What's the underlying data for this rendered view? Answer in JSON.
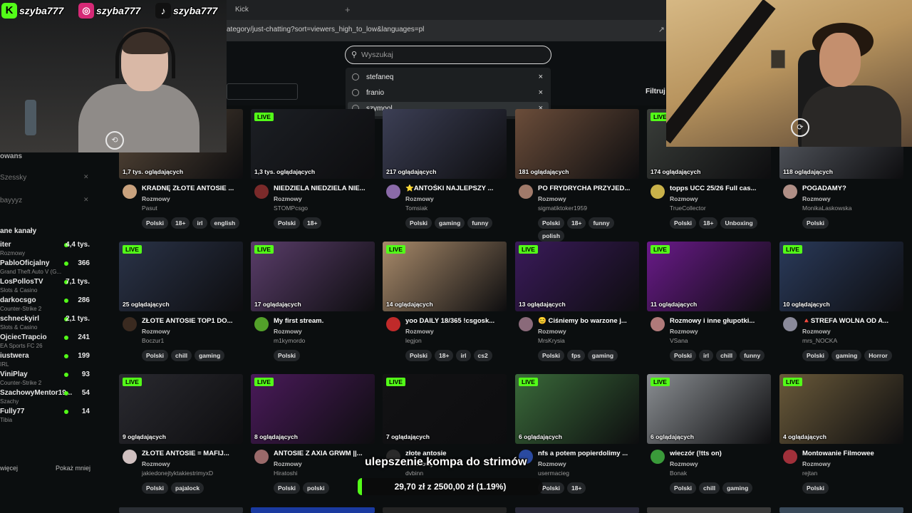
{
  "browser": {
    "tab_title": "Kick",
    "new_tab": "+",
    "url": "ategory/just-chatting?sort=viewers_high_to_low&languages=pl"
  },
  "search": {
    "placeholder": "Wyszukaj",
    "history": [
      {
        "label": "stefaneq",
        "remove": "×"
      },
      {
        "label": "franio",
        "remove": "×"
      },
      {
        "label": "szymool",
        "remove": "×"
      }
    ]
  },
  "filter_label": "Filtruj",
  "socials": [
    {
      "icon": "kick-logo-icon",
      "name": "szyba777",
      "color": "#53fc18"
    },
    {
      "icon": "instagram-icon",
      "name": "szyba777",
      "color": "#d62976"
    },
    {
      "icon": "tiktok-icon",
      "name": "szyba777",
      "color": "#111111"
    }
  ],
  "sidebar": {
    "top_items": [
      {
        "name": "owans"
      },
      {
        "name": "Szessky"
      },
      {
        "name": "bayyyz"
      }
    ],
    "section_title": "ane kanały",
    "channels": [
      {
        "name": "iter",
        "category": "Rozmowy",
        "viewers": "4,4 tys."
      },
      {
        "name": "PabloOficjalny",
        "category": "Grand Theft Auto V (G...",
        "viewers": "366"
      },
      {
        "name": "LosPollosTV",
        "category": "Slots & Casino",
        "viewers": "7,1 tys."
      },
      {
        "name": "darkocsgo",
        "category": "Counter-Strike 2",
        "viewers": "286"
      },
      {
        "name": "schneckyirl",
        "category": "Slots & Casino",
        "viewers": "2,1 tys."
      },
      {
        "name": "OjciecTrapcio",
        "category": "EA Sports FC 26",
        "viewers": "241"
      },
      {
        "name": "iustwera",
        "category": "IRL",
        "viewers": "199"
      },
      {
        "name": "ViniPlay",
        "category": "Counter-Strike 2",
        "viewers": "93"
      },
      {
        "name": "SzachowyMentor19...",
        "category": "Szachy",
        "viewers": "54"
      },
      {
        "name": "Fully77",
        "category": "Tibia",
        "viewers": "14"
      }
    ],
    "show_more": "więcej",
    "show_less": "Pokaż mniej"
  },
  "streams": [
    {
      "live": "",
      "viewers": "1,7 tys. oglądających",
      "title": "KRADNĘ ZŁOTE ANTOSIE ...",
      "category": "Rozmowy",
      "channel": "Pasut",
      "tags": [
        "Polski",
        "18+",
        "irl",
        "english"
      ],
      "thumb": "#5a4a3a",
      "avatar": "#c9a27e"
    },
    {
      "live": "LIVE",
      "viewers": "1,3 tys. oglądających",
      "title": "NIEDZIELA NIEDZIELA NIE...",
      "category": "Rozmowy",
      "channel": "STOMPcsgo",
      "tags": [
        "Polski",
        "18+"
      ],
      "thumb": "#1c1f24",
      "avatar": "#7a2a2a"
    },
    {
      "live": "",
      "viewers": "217 oglądających",
      "title": "⭐ANTOŚKI NAJLEPSZY ...",
      "category": "Rozmowy",
      "channel": "Tomsiak",
      "tags": [
        "Polski",
        "gaming",
        "funny"
      ],
      "thumb": "#3c3f55",
      "avatar": "#8a6aa8"
    },
    {
      "live": "",
      "viewers": "181 oglądających",
      "title": "PO FRYDRYCHA PRZYJED...",
      "category": "Rozmowy",
      "channel": "sigmatiktoker1959",
      "tags": [
        "Polski",
        "18+",
        "funny",
        "polish"
      ],
      "thumb": "#6b4d3a",
      "avatar": "#a07a6a"
    },
    {
      "live": "LIVE",
      "viewers": "174 oglądających",
      "title": "topps UCC 25/26 Full cas...",
      "category": "Rozmowy",
      "channel": "TrueCollector",
      "tags": [
        "Polski",
        "18+",
        "Unboxing"
      ],
      "thumb": "#3a3e3a",
      "avatar": "#c9b24a"
    },
    {
      "live": "",
      "viewers": "118 oglądających",
      "title": "POGADAMY?",
      "category": "Rozmowy",
      "channel": "MonikaLaskowska",
      "tags": [
        "Polski"
      ],
      "thumb": "#5c6068",
      "avatar": "#b08f86"
    },
    {
      "live": "LIVE",
      "viewers": "25 oglądających",
      "title": "ZŁOTE ANTOSIE TOP1 DO...",
      "category": "Rozmowy",
      "channel": "Boczur1",
      "tags": [
        "Polski",
        "chill",
        "gaming"
      ],
      "thumb": "#2a3348",
      "avatar": "#3a2a20"
    },
    {
      "live": "LIVE",
      "viewers": "17 oglądających",
      "title": "My first stream.",
      "category": "Rozmowy",
      "channel": "m1kymordo",
      "tags": [
        "Polski"
      ],
      "thumb": "#5a3d6a",
      "avatar": "#53a02a"
    },
    {
      "live": "LIVE",
      "viewers": "14 oglądających",
      "title": "yoo DAILY 18/365 !csgosk...",
      "category": "Rozmowy",
      "channel": "legjon",
      "tags": [
        "Polski",
        "18+",
        "irl",
        "cs2"
      ],
      "thumb": "#a88a6a",
      "avatar": "#c02a2a"
    },
    {
      "live": "LIVE",
      "viewers": "13 oglądających",
      "title": "😊 Ciśniemy bo warzone j...",
      "category": "Rozmowy",
      "channel": "MrsKrysia",
      "tags": [
        "Polski",
        "fps",
        "gaming"
      ],
      "thumb": "#3a1a5a",
      "avatar": "#8a6a7a"
    },
    {
      "live": "LIVE",
      "viewers": "11 oglądających",
      "title": "Rozmowy i inne głupotki...",
      "category": "Rozmowy",
      "channel": "VSana",
      "tags": [
        "Polski",
        "irl",
        "chill",
        "funny"
      ],
      "thumb": "#6a1a8a",
      "avatar": "#b07a7a"
    },
    {
      "live": "LIVE",
      "viewers": "10 oglądających",
      "title": "🔺STREFA WOLNA OD A...",
      "category": "Rozmowy",
      "channel": "mrs_NOCKA",
      "tags": [
        "Polski",
        "gaming",
        "Horror"
      ],
      "thumb": "#2a3a5a",
      "avatar": "#8a8a9a"
    },
    {
      "live": "LIVE",
      "viewers": "9 oglądających",
      "title": "ZŁOTE ANTOSIE = MAFIJ...",
      "category": "Rozmowy",
      "channel": "jakiedonejtyktakiestrimyxD",
      "tags": [
        "Polski",
        "pajalock"
      ],
      "thumb": "#2a2a30",
      "avatar": "#d0c0c0"
    },
    {
      "live": "LIVE",
      "viewers": "8 oglądających",
      "title": "ANTOSIE Z AXIA GRWM ||...",
      "category": "Rozmowy",
      "channel": "Hiratoshi",
      "tags": [
        "Polski",
        "polski"
      ],
      "thumb": "#4a1a5a",
      "avatar": "#9a6a6a"
    },
    {
      "live": "LIVE",
      "viewers": "7 oglądających",
      "title": "złote antosie",
      "category": "Rozmowy",
      "channel": "dvbinn",
      "tags": [],
      "thumb": "#121214",
      "avatar": "#2a2a2a"
    },
    {
      "live": "LIVE",
      "viewers": "6 oglądających",
      "title": "nfs a potem popierdolimy ...",
      "category": "Rozmowy",
      "channel": "usermacieg",
      "tags": [
        "Polski",
        "18+"
      ],
      "thumb": "#3a6a3a",
      "avatar": "#2a4aa0"
    },
    {
      "live": "LIVE",
      "viewers": "6 oglądających",
      "title": "wieczór (!tts on)",
      "category": "Rozmowy",
      "channel": "Bonak",
      "tags": [
        "Polski",
        "chill",
        "gaming"
      ],
      "thumb": "#8a8e92",
      "avatar": "#3a9a3a"
    },
    {
      "live": "LIVE",
      "viewers": "4 oglądających",
      "title": "Montowanie Filmowee",
      "category": "Rozmowy",
      "channel": "rejtan",
      "tags": [
        "Polski"
      ],
      "thumb": "#6a5a3a",
      "avatar": "#a0303a"
    }
  ],
  "overlay": {
    "goal_title": "ulepszenie kompa do strimów",
    "goal_progress": "29,70 zł z 2500,00 zł (1.19%)",
    "goal_fraction": 0.0119,
    "accent": "#53fc18"
  }
}
